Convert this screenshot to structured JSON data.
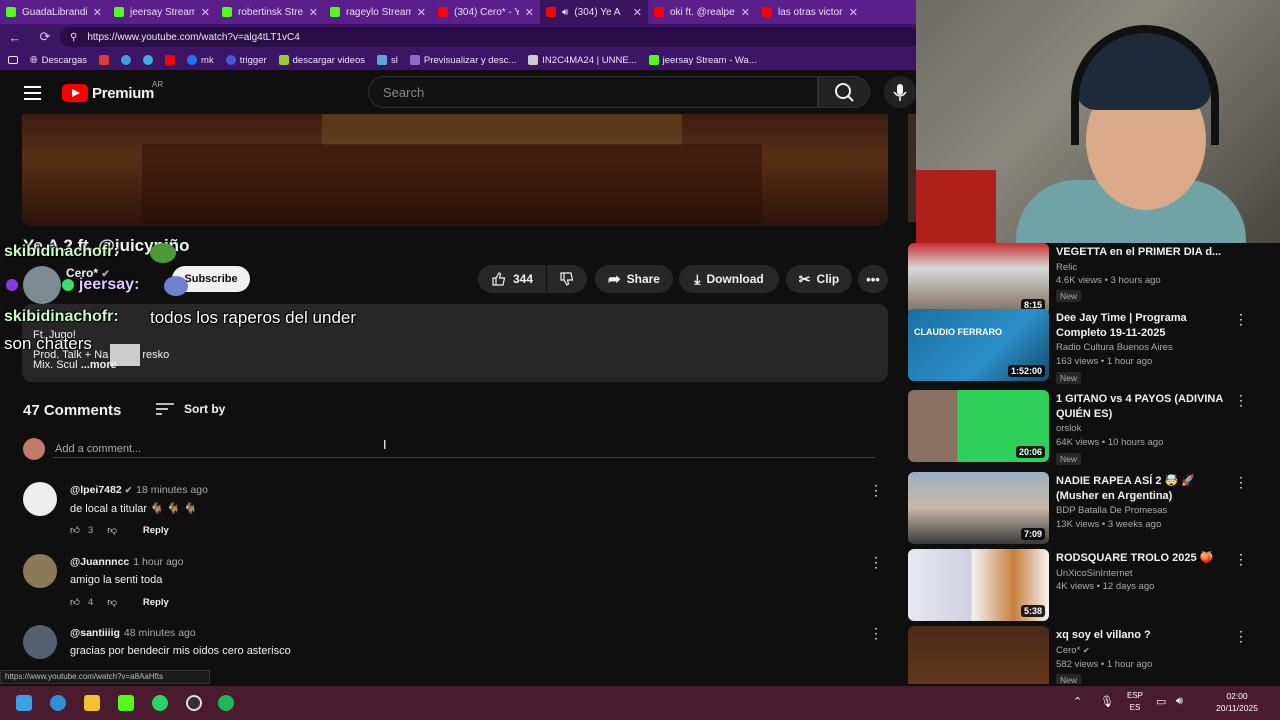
{
  "browser": {
    "tabs": [
      {
        "title": "GuadaLibrandi",
        "color": "#53fc18"
      },
      {
        "title": "jeersay Stream",
        "color": "#53fc18"
      },
      {
        "title": "robertinsk Stre",
        "color": "#53fc18"
      },
      {
        "title": "rageylo Stream",
        "color": "#53fc18"
      },
      {
        "title": "(304) Cero* - Y",
        "color": "#ff0000"
      },
      {
        "title": "(304) Ye A",
        "color": "#ff0000"
      },
      {
        "title": "oki ft. @realpe",
        "color": "#ff0000"
      },
      {
        "title": "las otras victor",
        "color": "#ff0000"
      }
    ],
    "url": "https://www.youtube.com/watch?v=alg4tLT1vC4",
    "bookmarks": [
      "Descargas",
      "mk",
      "trigger",
      "descargar videos",
      "sl",
      "Previsualizar y desc...",
      "IN2C4MA24 | UNNE...",
      "jeersay Stream - Wa..."
    ]
  },
  "header": {
    "logo": "Premium",
    "country": "AR",
    "search_placeholder": "Search"
  },
  "video": {
    "title": "Ye A 2 ft. @juicyniño",
    "channel": "Cero*",
    "subscribe": "Subscribe",
    "likes": "344",
    "share": "Share",
    "download": "Download",
    "clip": "Clip"
  },
  "description": {
    "line1": "Ft. Jugo!",
    "line2": "Prod. Talk + Na",
    "line2b": "resko",
    "line3": "Mix. Scul",
    "more": "...more"
  },
  "chat": {
    "user1": "skibidinachofr:",
    "user2": "jeersay:",
    "user3": "skibidinachofr:",
    "msg": "todos los raperos del under",
    "msg2": "son chaters"
  },
  "comments": {
    "count": "47 Comments",
    "sort": "Sort by",
    "placeholder": "Add a comment...",
    "reply_label": "Reply",
    "items": [
      {
        "author": "@lpei7482",
        "time": "18 minutes ago",
        "text": "de local a titular 🐐 🐐 🐐",
        "likes": "3"
      },
      {
        "author": "@Juannncc",
        "time": "1 hour ago",
        "text": "amigo la senti toda",
        "likes": "4"
      },
      {
        "author": "@santiiiig",
        "time": "48 minutes ago",
        "text": "gracias por bendecir mis oidos cero asterisco",
        "likes": "3"
      }
    ]
  },
  "status_url": "https://www.youtube.com/watch?v=a8AaHfts",
  "sidebar": [
    {
      "title": "VEGETTA en el PRIMER DIA d...",
      "channel": "Relic",
      "meta": "4.6K views • 3 hours ago",
      "duration": "8:15",
      "badge": "New"
    },
    {
      "title": "Dee Jay Time | Programa Completo 19-11-2025",
      "channel": "Radio Cultura Buenos Aires",
      "meta": "163 views • 1 hour ago",
      "duration": "1:52:00",
      "badge": "New",
      "thumb_text": "CLAUDIO FERRARO"
    },
    {
      "title": "1 GITANO vs 4 PAYOS (ADIVINA QUIÉN ES)",
      "channel": "orslok",
      "meta": "64K views • 10 hours ago",
      "duration": "20:06",
      "badge": "New"
    },
    {
      "title": "NADIE RAPEA ASÍ 2 🤯 🚀 (Musher en Argentina)",
      "channel": "BDP Batalla De Promesas",
      "meta": "13K views • 3 weeks ago",
      "duration": "7:09",
      "badge": ""
    },
    {
      "title": "RODSQUARE TROLO 2025 🍑",
      "channel": "UnXicoSinInternet",
      "meta": "4K views • 12 days ago",
      "duration": "5:38",
      "badge": ""
    },
    {
      "title": "xq soy el villano ?",
      "channel": "Cero*",
      "meta": "582 views • 1 hour ago",
      "duration": "",
      "badge": "New"
    }
  ],
  "taskbar": {
    "lang1": "ESP",
    "lang2": "ES",
    "time": "02:00",
    "date": "20/11/2025"
  }
}
